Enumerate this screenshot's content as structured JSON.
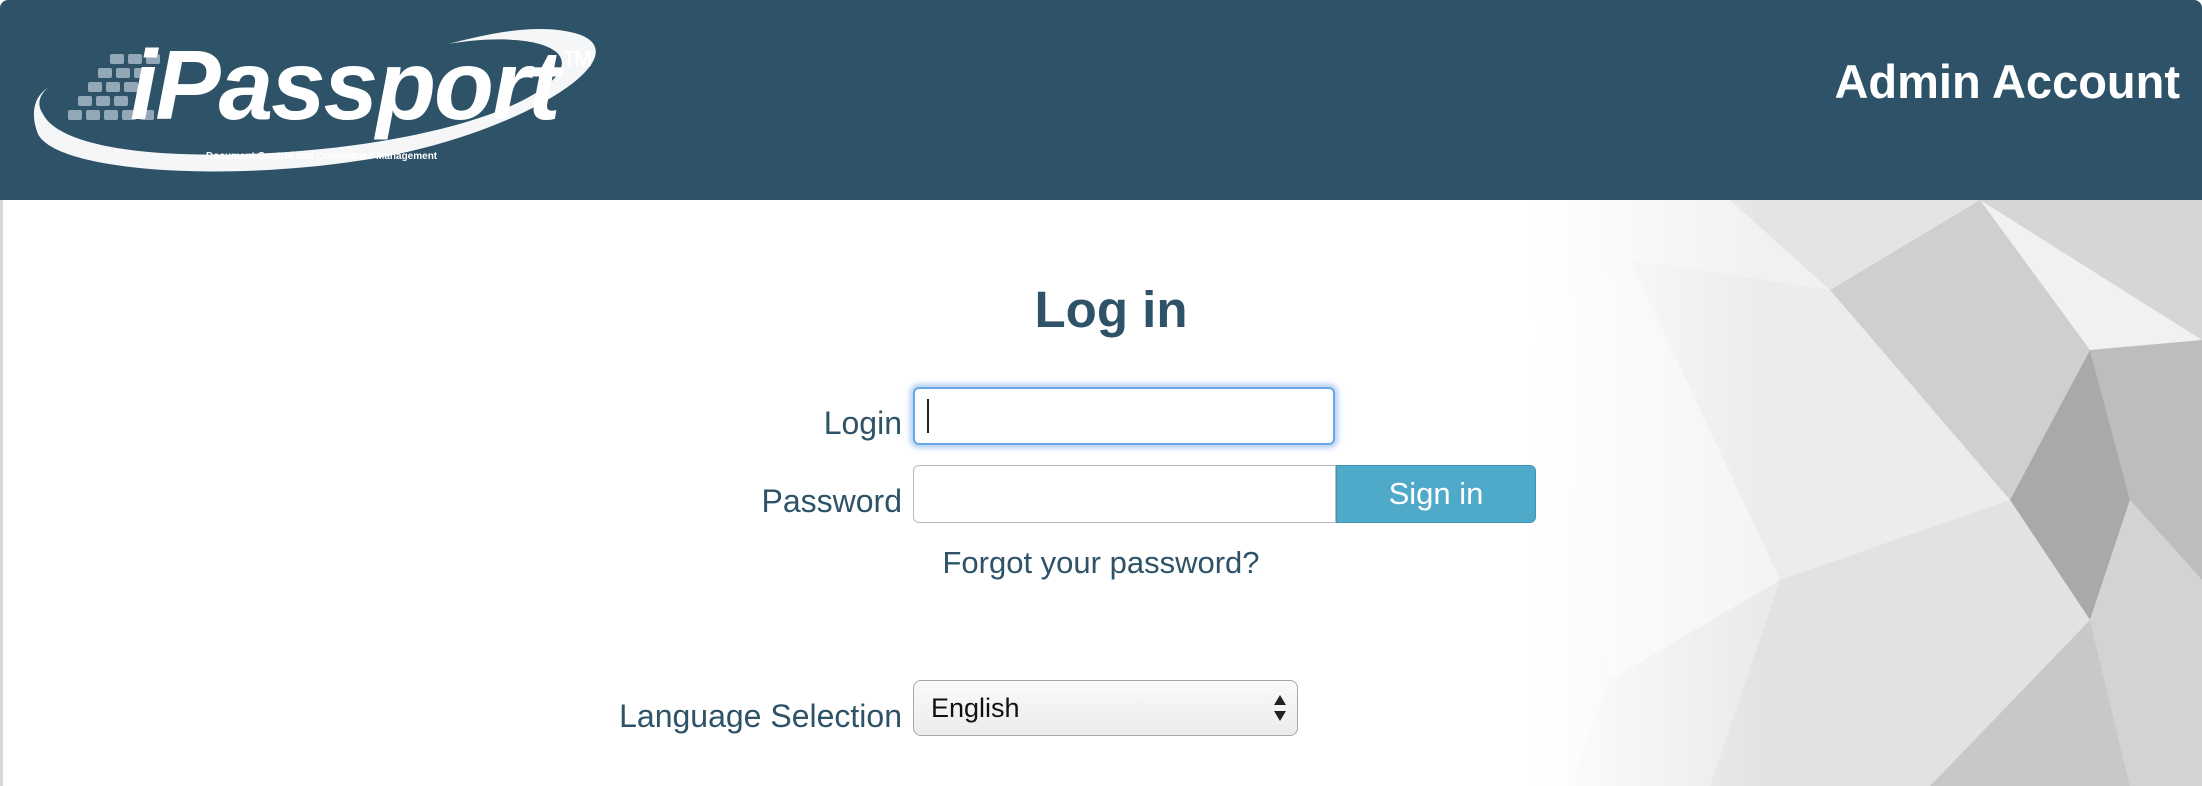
{
  "header": {
    "logo_text": "iPassport",
    "logo_trademark": "TM",
    "logo_tagline": "Document Control and Compliance Management",
    "account_title": "Admin Account",
    "background_color": "#2e5368"
  },
  "login_form": {
    "title": "Log in",
    "login_label": "Login",
    "login_value": "",
    "password_label": "Password",
    "password_value": "",
    "sign_in_label": "Sign in",
    "forgot_password_label": "Forgot your password?",
    "accent_color": "#4fa9c9"
  },
  "language": {
    "label": "Language Selection",
    "selected": "English"
  },
  "icons": {
    "select_arrows": "updown-arrows-icon"
  }
}
